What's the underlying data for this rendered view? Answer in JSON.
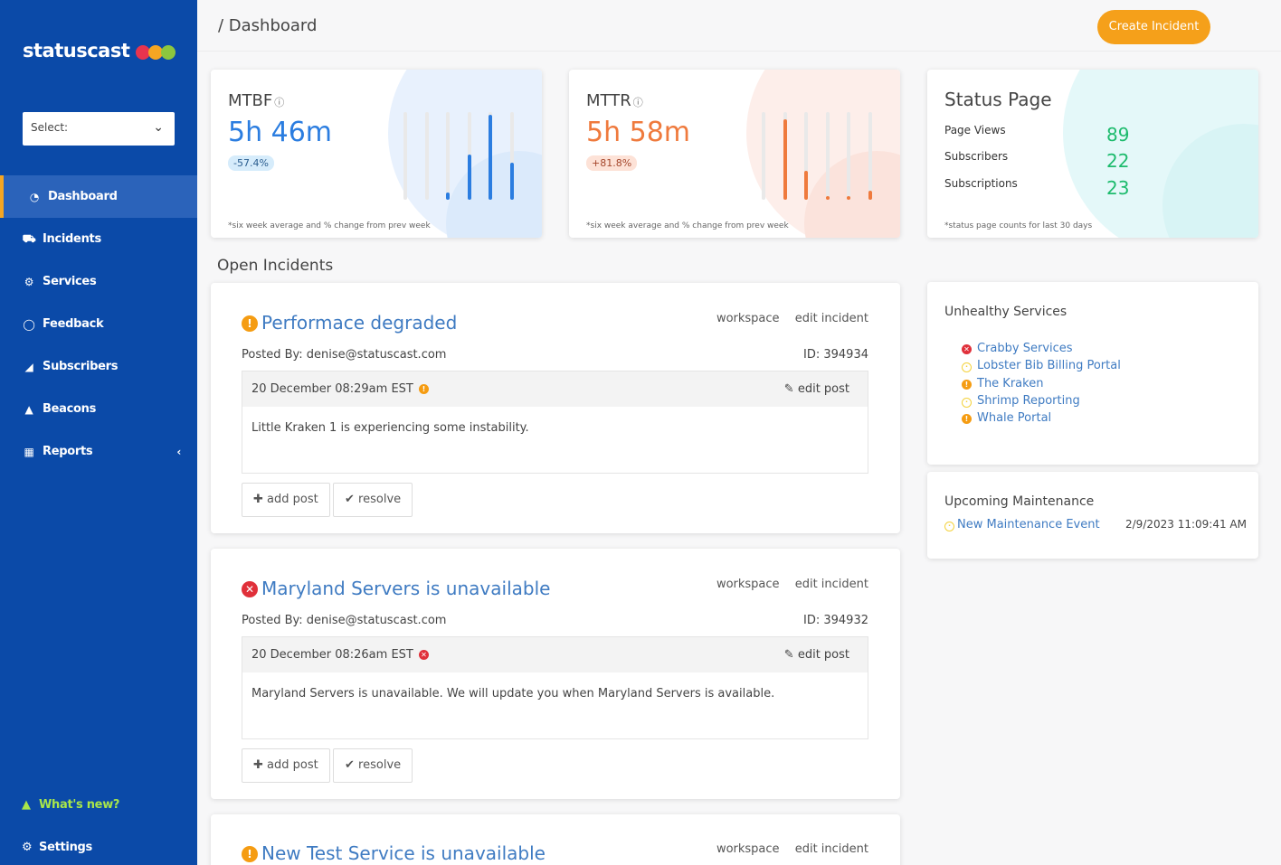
{
  "sidebar": {
    "logo": "statuscast",
    "logo_colors": [
      "#e8344e",
      "#f5a623",
      "#8cc63f"
    ],
    "select_label": "Select:",
    "items": [
      {
        "label": "Dashboard",
        "icon": "pie-chart-icon",
        "active": true
      },
      {
        "label": "Incidents",
        "icon": "truck-icon"
      },
      {
        "label": "Services",
        "icon": "cogs-icon"
      },
      {
        "label": "Feedback",
        "icon": "comment-icon"
      },
      {
        "label": "Subscribers",
        "icon": "bullhorn-icon"
      },
      {
        "label": "Beacons",
        "icon": "bell-icon"
      },
      {
        "label": "Reports",
        "icon": "grid-icon"
      }
    ],
    "whats_new": "What's new?",
    "settings": "Settings"
  },
  "header": {
    "breadcrumb": "/ Dashboard",
    "create_button": "Create Incident"
  },
  "metrics": {
    "mtbf": {
      "title": "MTBF",
      "value": "5h 46m",
      "change": "-57.4%",
      "footnote": "*six week average and % change from prev week",
      "color": "#2b7de0",
      "bars": [
        0,
        0,
        0.08,
        0.52,
        0.97,
        0.42
      ]
    },
    "mttr": {
      "title": "MTTR",
      "value": "5h 58m",
      "change": "+81.8%",
      "footnote": "*six week average and % change from prev week",
      "color": "#ef7a3d",
      "bars": [
        0,
        0.92,
        0.33,
        0.02,
        0.04,
        0.1
      ]
    },
    "status_page": {
      "title": "Status Page",
      "rows": [
        {
          "label": "Page Views",
          "value": "89"
        },
        {
          "label": "Subscribers",
          "value": "22"
        },
        {
          "label": "Subscriptions",
          "value": "23"
        }
      ],
      "footnote": "*status page counts for last 30 days"
    }
  },
  "open_incidents": {
    "title": "Open Incidents",
    "workspace_label": "workspace",
    "edit_incident_label": "edit incident",
    "edit_post_label": "edit post",
    "add_post_label": "add post",
    "resolve_label": "resolve",
    "items": [
      {
        "title": "Performace degraded",
        "status": "warning",
        "posted_by": "Posted By: denise@statuscast.com",
        "id": "ID: 394934",
        "post_date": "20 December 08:29am EST",
        "post_body": "Little Kraken 1 is experiencing some instability."
      },
      {
        "title": "Maryland Servers is unavailable",
        "status": "error",
        "posted_by": "Posted By: denise@statuscast.com",
        "id": "ID: 394932",
        "post_date": "20 December 08:26am EST",
        "post_body": "Maryland Servers is unavailable. We will update you when Maryland Servers is available."
      },
      {
        "title": "New Test Service is unavailable",
        "status": "warning"
      }
    ]
  },
  "unhealthy": {
    "title": "Unhealthy Services",
    "services": [
      {
        "name": "Crabby Services",
        "status": "error"
      },
      {
        "name": "Lobster Bib Billing Portal",
        "status": "pending"
      },
      {
        "name": "The Kraken",
        "status": "warning"
      },
      {
        "name": "Shrimp Reporting",
        "status": "pending"
      },
      {
        "name": "Whale Portal",
        "status": "warning"
      }
    ]
  },
  "maintenance": {
    "title": "Upcoming Maintenance",
    "event": "New Maintenance Event",
    "date": "2/9/2023 11:09:41 AM"
  },
  "colors": {
    "sidebar": "#0b4aa8",
    "accent": "#f5a01a",
    "link": "#3f7bc2",
    "warning": "#f59c12",
    "error": "#e0303a",
    "pending": "#f4d23c",
    "green": "#1dbb6d"
  }
}
